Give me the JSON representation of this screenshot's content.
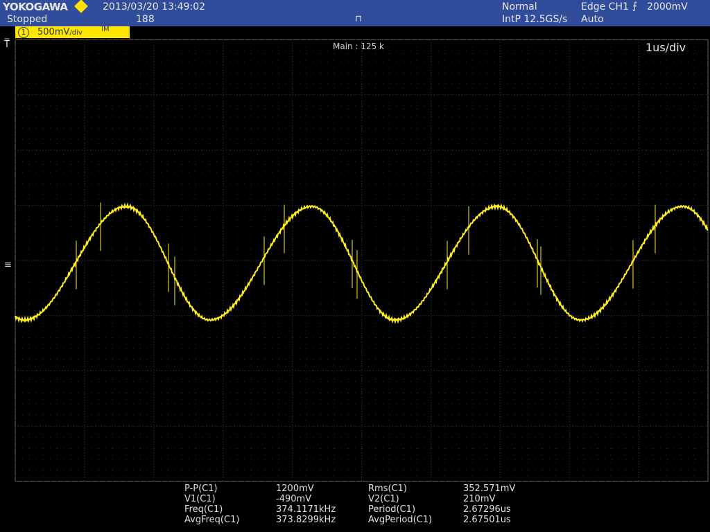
{
  "header": {
    "brand": "YOKOGAWA",
    "datetime": "2013/03/20 13:49:02",
    "status": "Stopped",
    "count": "188",
    "acq_mode": "Normal",
    "sample": "IntP 12.5GS/s",
    "trigger_type": "Edge CH1",
    "trigger_level": "2000mV",
    "trigger_mode": "Auto"
  },
  "channel": {
    "number": "1",
    "scale": "500mV",
    "unit_suffix": "/div",
    "tag": "IM"
  },
  "display": {
    "main_label": "Main : 125 k",
    "timebase": "1us/div"
  },
  "measurements": {
    "col1": [
      {
        "name": "P-P(C1)",
        "value": "1200mV"
      },
      {
        "name": "V1(C1)",
        "value": "-490mV"
      },
      {
        "name": "Freq(C1)",
        "value": "374.1171kHz"
      },
      {
        "name": "AvgFreq(C1)",
        "value": "373.8299kHz"
      }
    ],
    "col2": [
      {
        "name": "Rms(C1)",
        "value": "352.571mV"
      },
      {
        "name": "V2(C1)",
        "value": "210mV"
      },
      {
        "name": "Period(C1)",
        "value": "2.67296us"
      },
      {
        "name": "AvgPeriod(C1)",
        "value": "2.67501us"
      }
    ]
  },
  "colors": {
    "header_bg": "#324c9c",
    "trace": "#ffee22",
    "channel_badge": "#ffe600",
    "grid": "#5a5a5a"
  }
}
